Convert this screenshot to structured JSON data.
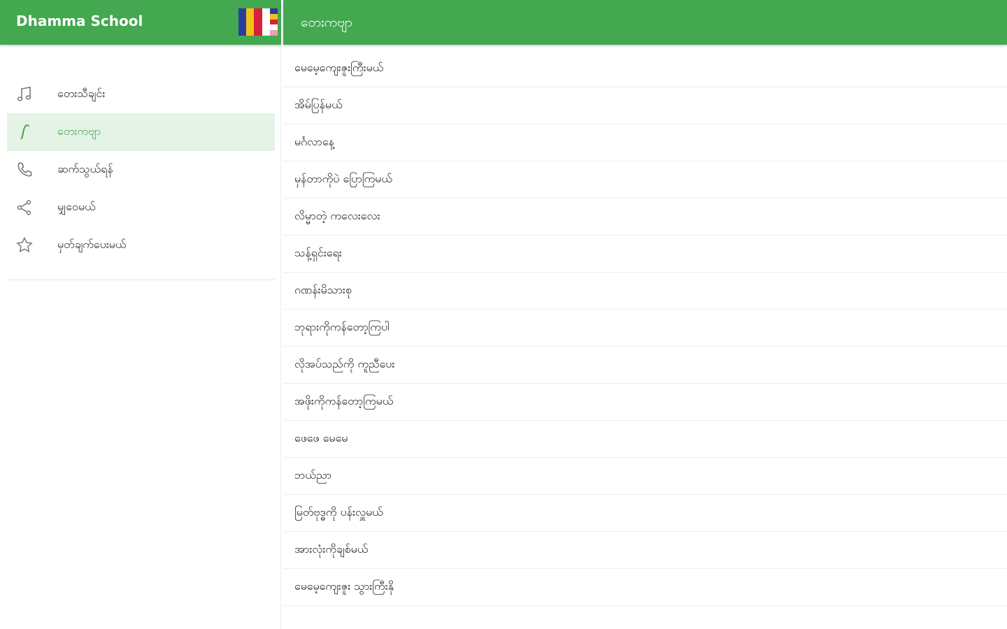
{
  "drawer": {
    "title": "Dhamma School",
    "items": [
      {
        "label": "တေးသီချင်း",
        "icon": "music-note-icon"
      },
      {
        "label": "တေးကဗျာ",
        "icon": "quill-icon"
      },
      {
        "label": "ဆက်သွယ်ရန်",
        "icon": "phone-icon"
      },
      {
        "label": "မျှဝေမယ်",
        "icon": "share-icon"
      },
      {
        "label": "မှတ်ချက်ပေးမယ်",
        "icon": "star-icon"
      }
    ],
    "active_index": 1
  },
  "header": {
    "title": "တေးကဗျာ"
  },
  "list": {
    "items": [
      "မေမေ့ကျေးဇူးကြီးမယ်",
      "အိမ်ပြန်မယ်",
      "မင်္ဂလာနေ့",
      "မှန်တာကိုပဲ ပြောကြမယ်",
      "လိမ္မာတဲ့ ကလေးလေး",
      "သန့်ရှင်းရေး",
      "ဂဏန်းမိသားစု",
      "ဘုရားကိုကန်တော့ကြပါ",
      "လိုအပ်သည်ကို ကူညီပေး",
      "အဖိုးကိုကန်တော့ကြမယ်",
      "ဖေဖေ မေမေ",
      "ဘယ်ညာ",
      "မြတ်ဗုဒ္ဓကို ပန်းလှူမယ်",
      "အားလုံးကိုချစ်မယ်",
      "မေမေ့ကျေးဇူး သွားကြီးနို"
    ]
  },
  "colors": {
    "primary": "#43a84f",
    "active_bg": "#e4f3e6"
  },
  "flag_colors": [
    "#2a3d9e",
    "#f2c21a",
    "#d8203a",
    "#ffffff",
    "#ee9fb0"
  ]
}
